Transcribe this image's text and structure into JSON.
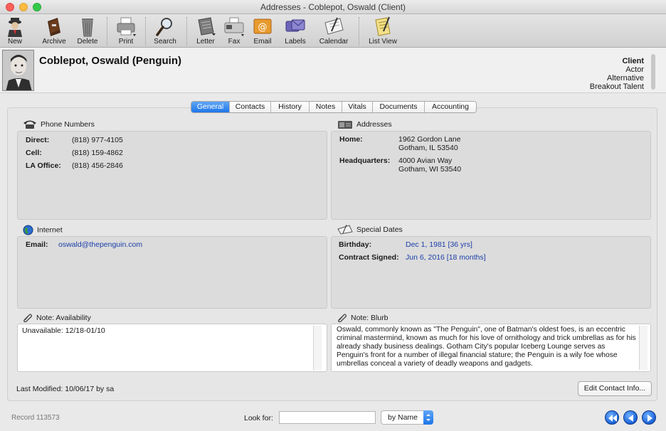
{
  "window": {
    "title": "Addresses - Coblepot, Oswald (Client)"
  },
  "toolbar": {
    "items": [
      {
        "label": "New",
        "icon": "new-contact-icon"
      },
      {
        "label": "Archive",
        "icon": "archive-icon"
      },
      {
        "label": "Delete",
        "icon": "trash-icon"
      },
      {
        "label": "Print",
        "icon": "printer-icon"
      },
      {
        "label": "Search",
        "icon": "magnifier-icon"
      },
      {
        "label": "Letter",
        "icon": "letter-icon"
      },
      {
        "label": "Fax",
        "icon": "fax-icon"
      },
      {
        "label": "Email",
        "icon": "email-icon"
      },
      {
        "label": "Labels",
        "icon": "labels-icon"
      },
      {
        "label": "Calendar",
        "icon": "calendar-icon"
      },
      {
        "label": "List View",
        "icon": "list-view-icon"
      }
    ]
  },
  "contact": {
    "name": "Coblepot, Oswald (Penguin)",
    "categories": [
      "Client",
      "Actor",
      "Alternative",
      "Breakout Talent"
    ]
  },
  "tabs": [
    "General",
    "Contacts",
    "History",
    "Notes",
    "Vitals",
    "Documents",
    "Accounting"
  ],
  "phones": {
    "title": "Phone Numbers",
    "rows": [
      {
        "label": "Direct:",
        "value": "(818) 977-4105"
      },
      {
        "label": "Cell:",
        "value": "(818) 159-4862"
      },
      {
        "label": "LA Office:",
        "value": "(818) 456-2846"
      }
    ]
  },
  "addresses": {
    "title": "Addresses",
    "rows": [
      {
        "label": "Home:",
        "line1": "1962 Gordon Lane",
        "line2": "Gotham, IL 53540"
      },
      {
        "label": "Headquarters:",
        "line1": "4000 Avian Way",
        "line2": "Gotham, WI 53540"
      }
    ]
  },
  "internet": {
    "title": "Internet",
    "rows": [
      {
        "label": "Email:",
        "value": "oswald@thepenguin.com"
      }
    ]
  },
  "special_dates": {
    "title": "Special Dates",
    "rows": [
      {
        "label": "Birthday:",
        "value": "Dec 1, 1981 [36  yrs]"
      },
      {
        "label": "Contract Signed:",
        "value": "Jun 6, 2016 [18 months]"
      }
    ]
  },
  "note_availability": {
    "title": "Note:  Availability",
    "text": "Unavailable: 12/18-01/10"
  },
  "note_blurb": {
    "title": "Note:  Blurb",
    "text": "Oswald, commonly known as \"The Penguin\", one of Batman's oldest foes, is an eccentric criminal mastermind, known as much for his love of ornithology and trick umbrellas as for his already shady business dealings. Gotham City's popular Iceberg Lounge serves as Penguin's front for a number of illegal financial stature; the Penguin is a wily foe whose umbrellas conceal a variety of deadly weapons and gadgets."
  },
  "footer": {
    "last_modified": "Last Modified: 10/06/17 by sa",
    "edit_button": "Edit Contact Info..."
  },
  "bottom": {
    "record": "Record 113573",
    "look_for_label": "Look for:",
    "look_for_value": "",
    "search_by": "by Name"
  },
  "colors": {
    "accent": "#1f76e8",
    "link": "#1a3ea8"
  }
}
